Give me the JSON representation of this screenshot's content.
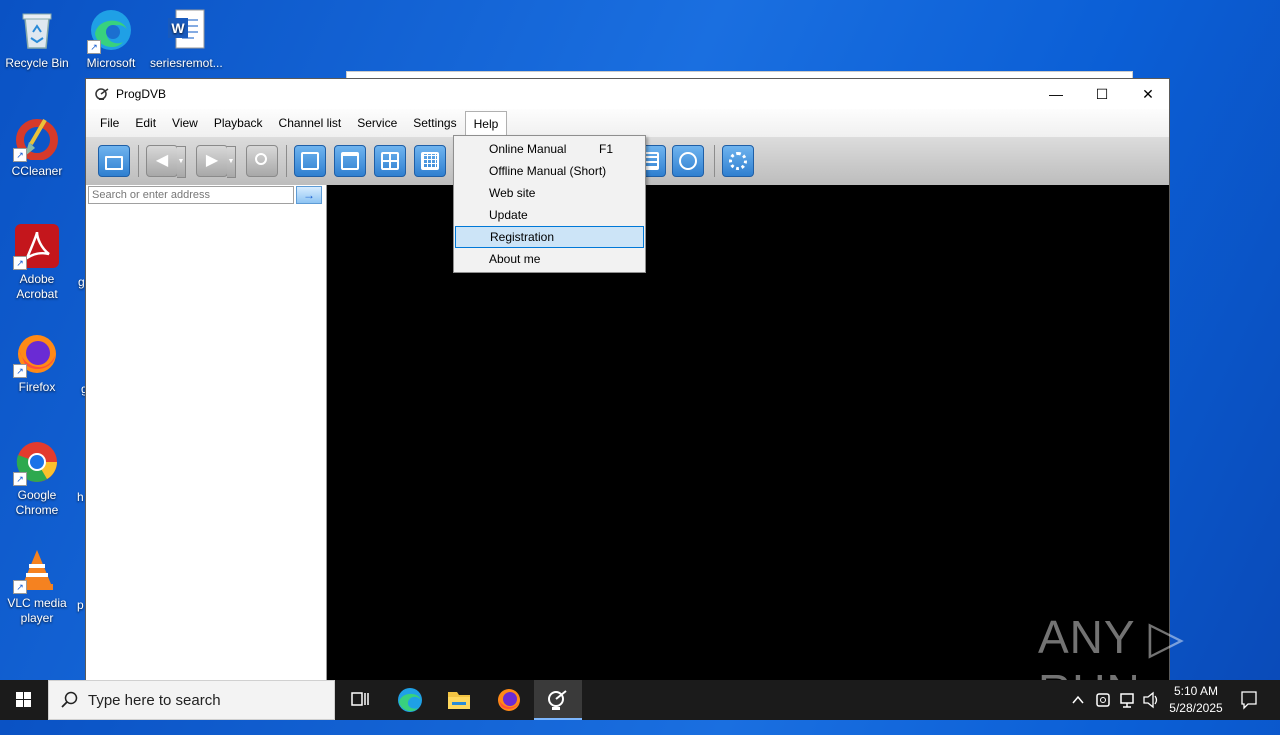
{
  "desktop": {
    "icons": [
      {
        "label": "Recycle Bin"
      },
      {
        "label": "Microsoft Edge"
      },
      {
        "label": "seriesremot..."
      },
      {
        "label": "CCleaner"
      },
      {
        "label": "Adobe Acrobat"
      },
      {
        "label": "Firefox"
      },
      {
        "label": "Google Chrome"
      },
      {
        "label": "VLC media player"
      }
    ],
    "cut_labels": [
      "g",
      "g",
      "h",
      "p"
    ]
  },
  "window": {
    "title": "ProgDVB",
    "controls": {
      "minimize": "—",
      "maximize": "☐",
      "close": "✕"
    }
  },
  "menubar": {
    "items": [
      "File",
      "Edit",
      "View",
      "Playback",
      "Channel list",
      "Service",
      "Settings",
      "Help"
    ]
  },
  "address": {
    "placeholder": "Search or enter address",
    "go_label": "→"
  },
  "help_menu": {
    "items": [
      {
        "label": "Online Manual",
        "shortcut": "F1"
      },
      {
        "label": "Offline Manual (Short)",
        "shortcut": ""
      },
      {
        "label": "Web site",
        "shortcut": ""
      },
      {
        "label": "Update",
        "shortcut": ""
      },
      {
        "label": "Registration",
        "shortcut": ""
      },
      {
        "label": "About me",
        "shortcut": ""
      }
    ],
    "highlighted": "Registration"
  },
  "watermark": "ANY ▷ RUN",
  "taskbar": {
    "search_placeholder": "Type here to search",
    "time": "5:10 AM",
    "date": "5/28/2025"
  },
  "colors": {
    "accent": "#0078d7",
    "highlight": "#cce4f7",
    "desktop": "#0b5fd6",
    "video_bg": "#000000"
  }
}
